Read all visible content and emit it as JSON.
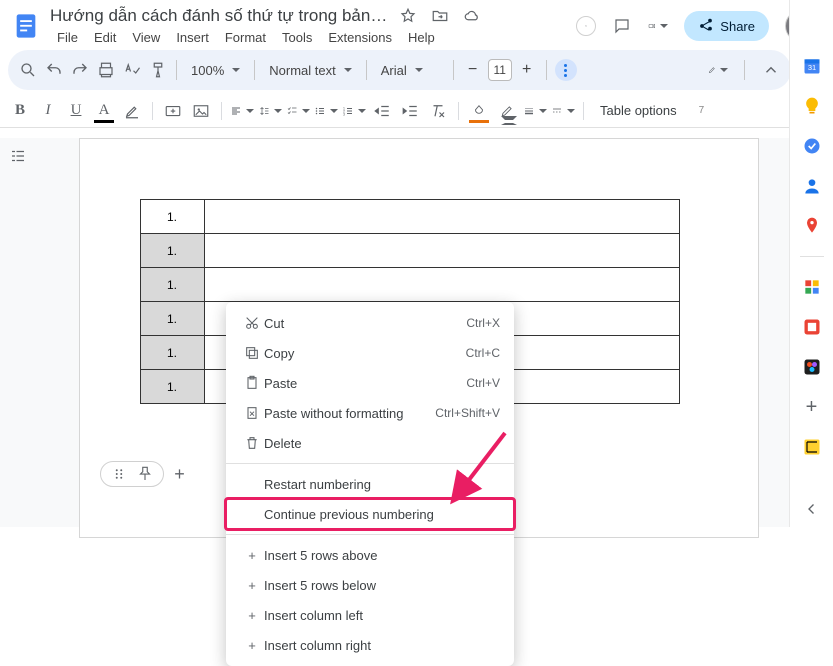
{
  "title": "Hướng dẫn cách đánh số thứ tự trong bảng Go...",
  "menus": [
    "File",
    "Edit",
    "View",
    "Insert",
    "Format",
    "Tools",
    "Extensions",
    "Help"
  ],
  "share": "Share",
  "toolbar": {
    "zoom": "100%",
    "style": "Normal text",
    "font": "Arial",
    "fontsize": "11",
    "table_options": "Table options"
  },
  "table": {
    "header_num": "1.",
    "rows": [
      "1.",
      "1.",
      "1.",
      "1.",
      "1."
    ]
  },
  "context_menu": {
    "cut": {
      "label": "Cut",
      "shortcut": "Ctrl+X"
    },
    "copy": {
      "label": "Copy",
      "shortcut": "Ctrl+C"
    },
    "paste": {
      "label": "Paste",
      "shortcut": "Ctrl+V"
    },
    "pastewo": {
      "label": "Paste without formatting",
      "shortcut": "Ctrl+Shift+V"
    },
    "delete": {
      "label": "Delete"
    },
    "restart": {
      "label": "Restart numbering"
    },
    "continue": {
      "label": "Continue previous numbering"
    },
    "ins_rows_above": {
      "label": "Insert 5 rows above"
    },
    "ins_rows_below": {
      "label": "Insert 5 rows below"
    },
    "ins_col_left": {
      "label": "Insert column left"
    },
    "ins_col_right": {
      "label": "Insert column right"
    }
  }
}
